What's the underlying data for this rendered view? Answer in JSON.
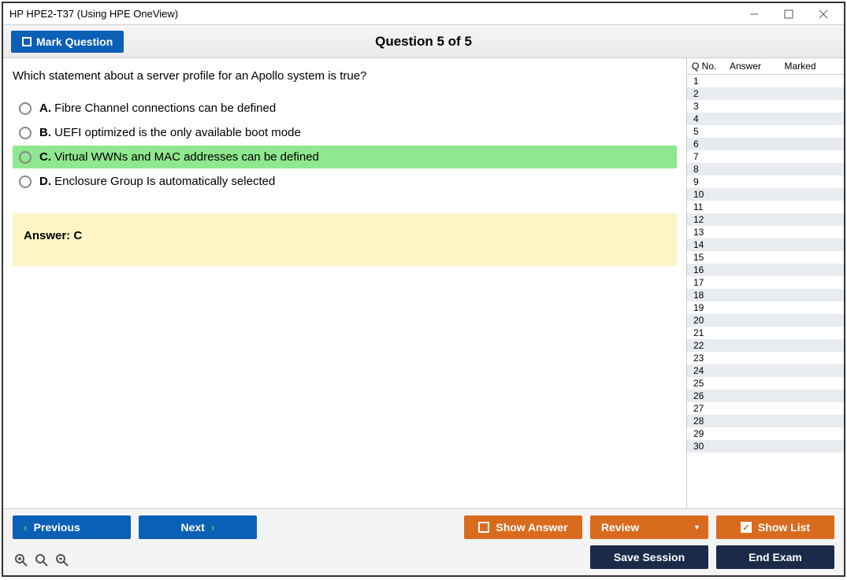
{
  "window": {
    "title": "HP HPE2-T37 (Using HPE OneView)"
  },
  "header": {
    "mark_label": "Mark Question",
    "question_title": "Question 5 of 5"
  },
  "question": {
    "text": "Which statement about a server profile for an Apollo system is true?",
    "options": [
      {
        "letter": "A.",
        "text": "Fibre Channel connections can be defined",
        "correct": false
      },
      {
        "letter": "B.",
        "text": "UEFI optimized is the only available boot mode",
        "correct": false
      },
      {
        "letter": "C.",
        "text": "Virtual WWNs and MAC addresses can be defined",
        "correct": true
      },
      {
        "letter": "D.",
        "text": "Enclosure Group Is automatically selected",
        "correct": false
      }
    ],
    "answer_label": "Answer: C"
  },
  "sidebar": {
    "col_qno": "Q No.",
    "col_answer": "Answer",
    "col_marked": "Marked",
    "rows": [
      1,
      2,
      3,
      4,
      5,
      6,
      7,
      8,
      9,
      10,
      11,
      12,
      13,
      14,
      15,
      16,
      17,
      18,
      19,
      20,
      21,
      22,
      23,
      24,
      25,
      26,
      27,
      28,
      29,
      30
    ]
  },
  "buttons": {
    "previous": "Previous",
    "next": "Next",
    "show_answer": "Show Answer",
    "review": "Review",
    "show_list": "Show List",
    "save_session": "Save Session",
    "end_exam": "End Exam"
  }
}
